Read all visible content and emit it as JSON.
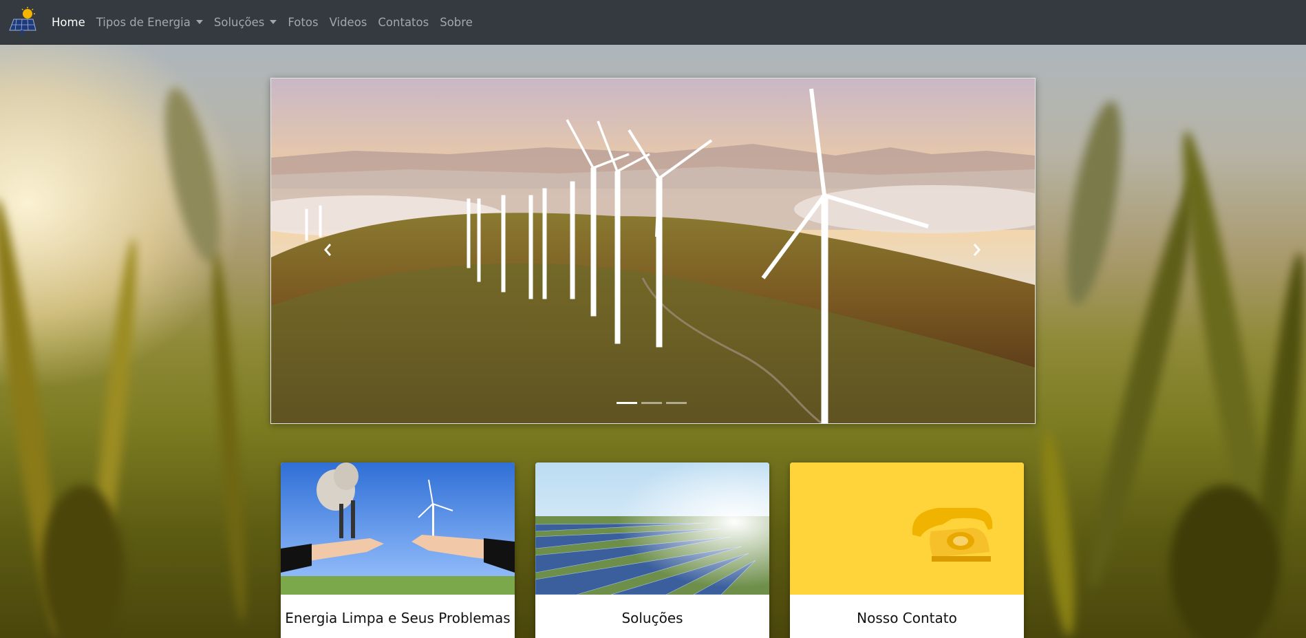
{
  "navbar": {
    "brand_icon": "solar-panel-sun-icon",
    "items": [
      {
        "label": "Home",
        "active": true,
        "dropdown": false
      },
      {
        "label": "Tipos de Energia",
        "active": false,
        "dropdown": true
      },
      {
        "label": "Soluções",
        "active": false,
        "dropdown": true
      },
      {
        "label": "Fotos",
        "active": false,
        "dropdown": false
      },
      {
        "label": "Videos",
        "active": false,
        "dropdown": false
      },
      {
        "label": "Contatos",
        "active": false,
        "dropdown": false
      },
      {
        "label": "Sobre",
        "active": false,
        "dropdown": false
      }
    ]
  },
  "carousel": {
    "slide_subject": "wind-turbines-on-hills",
    "indicators": 3,
    "active_index": 0,
    "prev_icon": "chevron-left-icon",
    "next_icon": "chevron-right-icon"
  },
  "cards": [
    {
      "title": "Energia Limpa e Seus Problemas",
      "image": "hands-factory-vs-wind-turbine"
    },
    {
      "title": "Soluções",
      "image": "solar-panel-field"
    },
    {
      "title": "Nosso Contato",
      "image": "yellow-rotary-telephone"
    }
  ],
  "colors": {
    "navbar_bg": "#343a40",
    "nav_link": "rgba(255,255,255,0.55)",
    "nav_link_active": "#ffffff",
    "contact_card_bg": "#ffd43b"
  }
}
